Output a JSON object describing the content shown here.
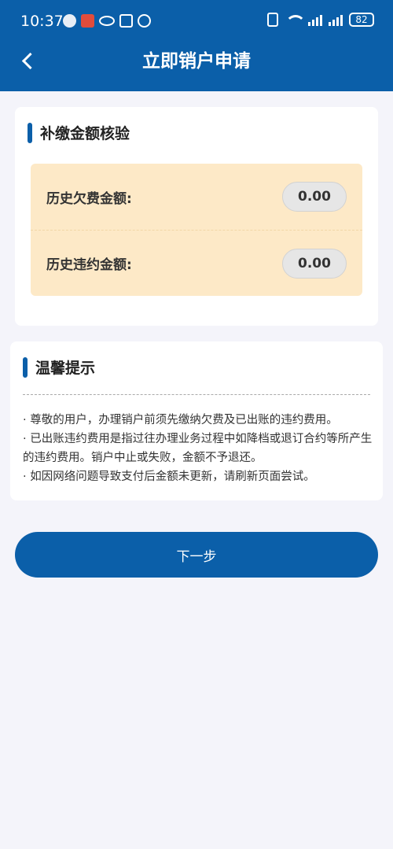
{
  "status_bar": {
    "time": "10:37",
    "battery": "82"
  },
  "header": {
    "title": "立即销户申请",
    "back_icon": "chevron-left-icon"
  },
  "fee_check": {
    "section_title": "补缴金额核验",
    "rows": [
      {
        "label": "历史欠费金额:",
        "value": "0.00"
      },
      {
        "label": "历史违约金额:",
        "value": "0.00"
      }
    ]
  },
  "tips": {
    "section_title": "温馨提示",
    "lines": [
      "· 尊敬的用户，办理销户前须先缴纳欠费及已出账的违约费用。",
      "· 已出账违约费用是指过往办理业务过程中如降档或退订合约等所产生的违约费用。销户中止或失败，金额不予退还。",
      "· 如因网络问题导致支付后金额未更新，请刷新页面尝试。"
    ]
  },
  "actions": {
    "next_label": "下一步"
  },
  "colors": {
    "brand": "#0b5fa9",
    "amount_box_bg": "#fde9c7",
    "page_bg": "#f4f4fa"
  }
}
